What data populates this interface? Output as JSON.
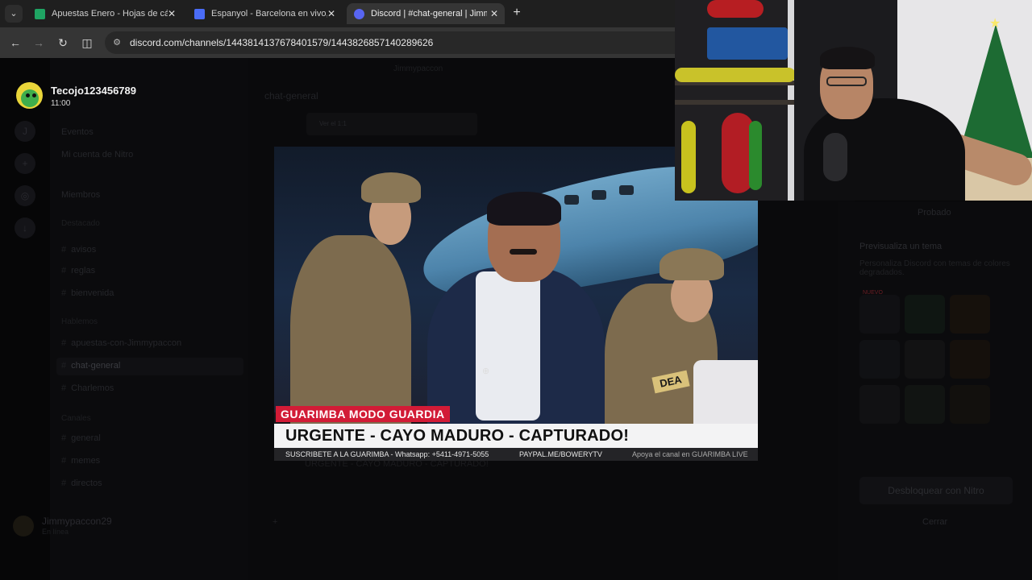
{
  "browser": {
    "tabs": [
      {
        "title": "Apuestas Enero - Hojas de cálc",
        "icon_color": "#1fa463",
        "active": false
      },
      {
        "title": "Espanyol - Barcelona en vivo, m",
        "icon_color": "#4a6cf7",
        "active": false
      },
      {
        "title": "Discord | #chat-general | Jimmy",
        "icon_color": "#5865f2",
        "active": true
      }
    ],
    "new_tab_label": "+",
    "url": "discord.com/channels/1443814137678401579/1443826857140289626"
  },
  "discord": {
    "profile": {
      "name": "Tecojo123456789",
      "time": "11:00"
    },
    "top_name": "Jimmypaccon",
    "channel_title": "chat-general",
    "search_hint": "Ver el 1:1",
    "sidebar": [
      {
        "label": "Eventos",
        "kind": "item"
      },
      {
        "label": "Mi cuenta de Nitro",
        "kind": "item"
      },
      {
        "label": "Miembros",
        "kind": "item"
      },
      {
        "label": "Destacado",
        "kind": "section"
      },
      {
        "label": "avisos",
        "kind": "channel"
      },
      {
        "label": "reglas",
        "kind": "channel"
      },
      {
        "label": "bienvenida",
        "kind": "channel"
      },
      {
        "label": "Hablemos",
        "kind": "section"
      },
      {
        "label": "apuestas-con-Jimmypaccon",
        "kind": "channel"
      },
      {
        "label": "chat-general",
        "kind": "channel",
        "active": true
      },
      {
        "label": "Charlemos",
        "kind": "channel"
      },
      {
        "label": "Canales",
        "kind": "section"
      },
      {
        "label": "general",
        "kind": "channel"
      },
      {
        "label": "memes",
        "kind": "channel"
      },
      {
        "label": "directos",
        "kind": "channel"
      }
    ],
    "user_bar": {
      "name": "Jimmypaccon29",
      "status": "En línea"
    },
    "ghost_caption": "URGENTE - CAYO MADURO - CAPTURADO!",
    "right_panel": {
      "title": "Probado",
      "heading": "Previsualiza un tema",
      "subtitle": "Personaliza Discord con temas de colores degradados.",
      "badge": "NUEVO",
      "unlock_button": "Desbloquear con Nitro",
      "close_label": "Cerrar"
    }
  },
  "viewer": {
    "tag": "GUARIMBA MODO GUARDIA",
    "headline": "URGENTE - CAYO MADURO - CAPTURADO!",
    "sub_left": "SUSCRIBETE A LA GUARIMBA - Whatsapp: +5411-4971-5055",
    "sub_right": "PAYPAL.ME/BOWERYTV",
    "sub_far": "Apoya el canal en GUARIMBA LIVE",
    "patch_text": "DEA"
  },
  "colors": {
    "discord_blurple": "#5865f2",
    "tag_red": "#d21b36"
  }
}
